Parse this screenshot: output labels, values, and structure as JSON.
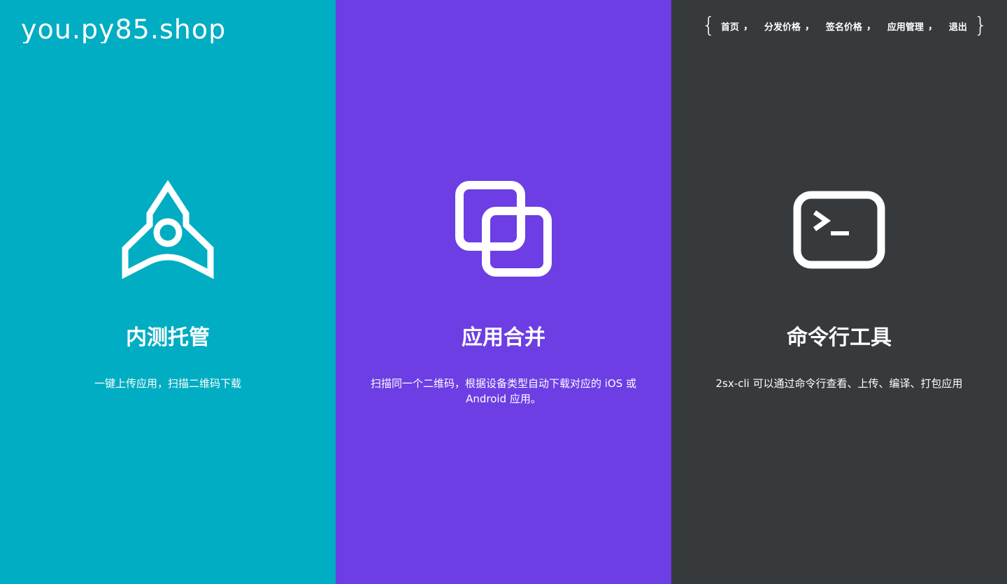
{
  "site": {
    "logo_text": "you.py85.shop"
  },
  "nav": {
    "open_brace": "{",
    "close_brace": "}",
    "separator": "，",
    "items": [
      {
        "label": "首页"
      },
      {
        "label": "分发价格"
      },
      {
        "label": "签名价格"
      },
      {
        "label": "应用管理"
      },
      {
        "label": "退出"
      }
    ]
  },
  "features": [
    {
      "icon": "rocket-icon",
      "title": "内测托管",
      "description": "一键上传应用，扫描二维码下载",
      "bg_color": "#00adc2"
    },
    {
      "icon": "merge-squares-icon",
      "title": "应用合并",
      "description": "扫描同一个二维码，根据设备类型自动下载对应的 iOS 或 Android 应用。",
      "bg_color": "#6c3ee4"
    },
    {
      "icon": "terminal-icon",
      "title": "命令行工具",
      "description": "2sx-cli 可以通过命令行查看、上传、编译、打包应用",
      "bg_color": "#363a3d"
    }
  ]
}
